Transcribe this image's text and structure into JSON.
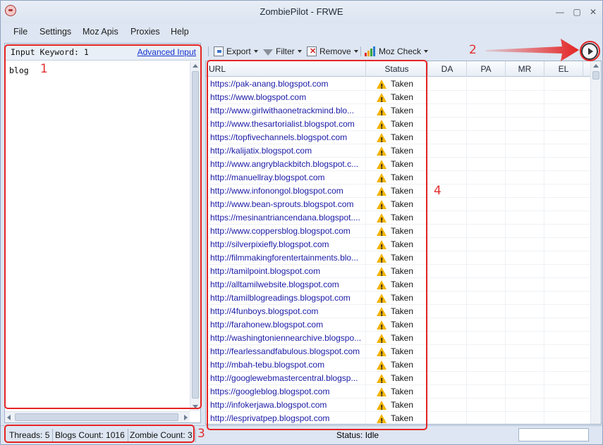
{
  "window": {
    "title": "ZombiePilot - FRWE",
    "min_glyph": "—",
    "max_glyph": "▢",
    "close_glyph": "✕"
  },
  "menu": [
    "File",
    "Settings",
    "Moz Apis",
    "Proxies",
    "Help"
  ],
  "keyword_panel": {
    "label": "Input Keyword: 1",
    "advanced_link": "Advanced Input",
    "text": "blog"
  },
  "toolbar": {
    "export": "Export",
    "filter": "Filter",
    "remove": "Remove",
    "moz_check": "Moz Check"
  },
  "table": {
    "headers": [
      "URL",
      "Status",
      "DA",
      "PA",
      "MR",
      "EL"
    ],
    "rows": [
      {
        "url": "https://pak-anang.blogspot.com",
        "status": "Taken"
      },
      {
        "url": "https://www.blogspot.com",
        "status": "Taken"
      },
      {
        "url": "http://www.girlwithaonetrackmind.blo...",
        "status": "Taken"
      },
      {
        "url": "http://www.thesartorialist.blogspot.com",
        "status": "Taken"
      },
      {
        "url": "https://topfivechannels.blogspot.com",
        "status": "Taken"
      },
      {
        "url": "http://kalijatix.blogspot.com",
        "status": "Taken"
      },
      {
        "url": "http://www.angryblackbitch.blogspot.c...",
        "status": "Taken"
      },
      {
        "url": "http://manuellray.blogspot.com",
        "status": "Taken"
      },
      {
        "url": "http://www.infonongol.blogspot.com",
        "status": "Taken"
      },
      {
        "url": "http://www.bean-sprouts.blogspot.com",
        "status": "Taken"
      },
      {
        "url": "https://mesinantriancendana.blogspot....",
        "status": "Taken"
      },
      {
        "url": "http://www.coppersblog.blogspot.com",
        "status": "Taken"
      },
      {
        "url": "http://silverpixiefly.blogspot.com",
        "status": "Taken"
      },
      {
        "url": "http://filmmakingforentertainments.blo...",
        "status": "Taken"
      },
      {
        "url": "http://tamilpoint.blogspot.com",
        "status": "Taken"
      },
      {
        "url": "http://alltamilwebsite.blogspot.com",
        "status": "Taken"
      },
      {
        "url": "http://tamilblogreadings.blogspot.com",
        "status": "Taken"
      },
      {
        "url": "http://4funboys.blogspot.com",
        "status": "Taken"
      },
      {
        "url": "http://farahonew.blogspot.com",
        "status": "Taken"
      },
      {
        "url": "http://washingtoniennearchive.blogspo...",
        "status": "Taken"
      },
      {
        "url": "http://fearlessandfabulous.blogspot.com",
        "status": "Taken"
      },
      {
        "url": "http://mbah-tebu.blogspot.com",
        "status": "Taken"
      },
      {
        "url": "http://googlewebmastercentral.blogsp...",
        "status": "Taken"
      },
      {
        "url": "https://googleblog.blogspot.com",
        "status": "Taken"
      },
      {
        "url": "http://infokerjawa.blogspot.com",
        "status": "Taken"
      },
      {
        "url": "http://lesprivatpep.blogspot.com",
        "status": "Taken"
      }
    ]
  },
  "statusbar": {
    "threads": "Threads: 5",
    "blogs_count": "Blogs Count: 1016",
    "zombie_count": "Zombie Count: 3",
    "status": "Status: Idle"
  },
  "annotations": {
    "n1": "1",
    "n2": "2",
    "n3": "3",
    "n4": "4"
  },
  "colors": {
    "annotation": "#e52424",
    "link": "#1a1aa6",
    "warning": "#f3b300"
  }
}
